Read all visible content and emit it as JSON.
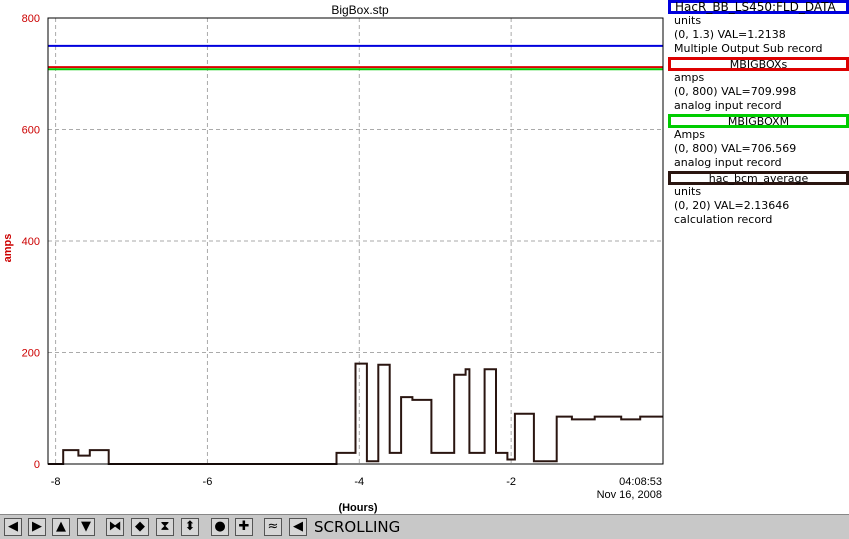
{
  "window": {
    "title": "BigBox.stp",
    "timestamp_time": "04:08:53",
    "timestamp_date": "Nov 16, 2008"
  },
  "colors": {
    "blue": "#0000dd",
    "red": "#dd0000",
    "green": "#00cc00",
    "brown": "#2a1510",
    "axis_label": "#cc0000"
  },
  "chart_data": {
    "type": "line",
    "title": "BigBox.stp",
    "xlabel": "(Hours)",
    "ylabel": "amps",
    "xlim": [
      -8.1,
      0
    ],
    "ylim": [
      0,
      800
    ],
    "x_ticks": [
      -8,
      -6,
      -4,
      -2
    ],
    "y_ticks": [
      0,
      200,
      400,
      600,
      800
    ],
    "grid": true,
    "series": [
      {
        "name": "HacR_BB_LS450:FLD_DATA",
        "color": "#0000dd",
        "x": [
          -8.1,
          0
        ],
        "y": [
          750,
          750
        ]
      },
      {
        "name": "MBIGBOXs",
        "color": "#dd0000",
        "x": [
          -8.1,
          0
        ],
        "y": [
          712,
          712
        ]
      },
      {
        "name": "MBIGBOXM",
        "color": "#00cc00",
        "x": [
          -8.1,
          0
        ],
        "y": [
          708,
          708
        ]
      },
      {
        "name": "hac_bcm_average",
        "color": "#2a1510",
        "style": "step",
        "x": [
          -8.1,
          -7.9,
          -7.9,
          -7.7,
          -7.7,
          -7.55,
          -7.55,
          -7.3,
          -7.3,
          -7.15,
          -7.15,
          -5.5,
          -4.3,
          -4.3,
          -4.05,
          -4.05,
          -3.9,
          -3.9,
          -3.75,
          -3.75,
          -3.6,
          -3.6,
          -3.45,
          -3.45,
          -3.3,
          -3.3,
          -3.05,
          -3.05,
          -2.75,
          -2.75,
          -2.6,
          -2.6,
          -2.55,
          -2.55,
          -2.35,
          -2.35,
          -2.2,
          -2.2,
          -2.05,
          -2.05,
          -1.95,
          -1.95,
          -1.7,
          -1.7,
          -1.4,
          -1.4,
          -1.2,
          -1.2,
          -0.9,
          -0.9,
          -0.55,
          -0.55,
          -0.3,
          -0.3,
          0
        ],
        "y": [
          0,
          0,
          25,
          25,
          15,
          15,
          25,
          25,
          0,
          0,
          0,
          0,
          0,
          20,
          20,
          180,
          180,
          5,
          5,
          178,
          178,
          20,
          20,
          120,
          120,
          115,
          115,
          20,
          20,
          160,
          160,
          170,
          170,
          20,
          20,
          170,
          170,
          20,
          20,
          8,
          8,
          90,
          90,
          5,
          5,
          85,
          85,
          80,
          80,
          85,
          85,
          80,
          80,
          85,
          85
        ]
      }
    ],
    "legend": [
      {
        "name": "HacR_BB_LS450:FLD_DATA",
        "units": "units",
        "range": "(0, 1.3) VAL=1.2138",
        "type": "Multiple Output Sub record",
        "color": "#0000dd"
      },
      {
        "name": "MBIGBOXs",
        "units": "amps",
        "range": "(0, 800) VAL=709.998",
        "type": "analog input record",
        "color": "#dd0000"
      },
      {
        "name": "MBIGBOXM",
        "units": "Amps",
        "range": "(0, 800) VAL=706.569",
        "type": "analog input record",
        "color": "#00cc00"
      },
      {
        "name": "hac_bcm_average",
        "units": "units",
        "range": "(0, 20) VAL=2.13646",
        "type": "calculation record",
        "color": "#2a1510"
      }
    ]
  },
  "toolbar": {
    "buttons": [
      {
        "name": "pan-left-button",
        "icon": "arrow-left-icon",
        "glyph": "◀"
      },
      {
        "name": "pan-right-button",
        "icon": "arrow-right-icon",
        "glyph": "▶"
      },
      {
        "name": "pan-up-button",
        "icon": "arrow-up-icon",
        "glyph": "▲"
      },
      {
        "name": "pan-down-button",
        "icon": "arrow-down-icon",
        "glyph": "▼"
      },
      {
        "name": "zoom-in-x-button",
        "icon": "zoom-in-horizontal-icon",
        "glyph": "⧓"
      },
      {
        "name": "zoom-out-x-button",
        "icon": "zoom-out-horizontal-icon",
        "glyph": "◆"
      },
      {
        "name": "zoom-in-y-button",
        "icon": "zoom-in-vertical-icon",
        "glyph": "⧗"
      },
      {
        "name": "zoom-out-y-button",
        "icon": "zoom-out-vertical-icon",
        "glyph": "⬍"
      },
      {
        "name": "reset-button",
        "icon": "circle-icon",
        "glyph": "●"
      },
      {
        "name": "add-button",
        "icon": "plus-icon",
        "glyph": "✚"
      },
      {
        "name": "auto-scale-button",
        "icon": "auto-scale-icon",
        "glyph": "≈"
      },
      {
        "name": "scroll-button",
        "icon": "scroll-back-icon",
        "glyph": "◀"
      }
    ],
    "status": "SCROLLING"
  }
}
